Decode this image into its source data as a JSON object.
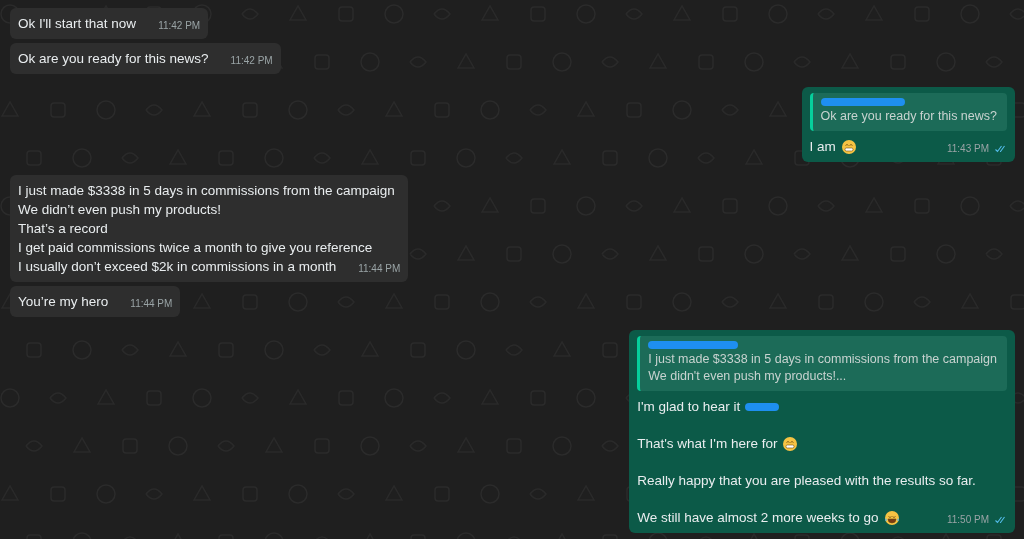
{
  "messages": [
    {
      "sent": false,
      "lines": [
        {
          "text": "Ok I'll start that now"
        }
      ],
      "time": "11:42 PM"
    },
    {
      "sent": false,
      "lines": [
        {
          "text": "Ok are you ready for this news?"
        }
      ],
      "time": "11:42 PM"
    },
    {
      "sent": true,
      "quote": {
        "author_redacted": true,
        "lines": [
          "Ok are you ready for this news?"
        ]
      },
      "lines": [
        {
          "text": "I am",
          "emoji": {
            "kind": "grin"
          }
        }
      ],
      "time": "11:43 PM",
      "read": true
    },
    {
      "sent": false,
      "lines": [
        {
          "text": "I just made $3338 in 5 days in commissions from the campaign"
        },
        {
          "text": "We didn’t even push my products!"
        },
        {
          "text": "That’s a record"
        },
        {
          "text": "I get paid commissions twice a month to give you reference"
        },
        {
          "text": "I usually don’t exceed $2k in commissions in a month"
        }
      ],
      "time": "11:44 PM"
    },
    {
      "sent": false,
      "lines": [
        {
          "text": "You’re my hero"
        }
      ],
      "time": "11:44 PM"
    },
    {
      "sent": true,
      "quote": {
        "author_redacted": true,
        "lines": [
          "I just made $3338 in 5 days in commissions from the campaign",
          "We didn't even push my products!..."
        ]
      },
      "lines": [
        {
          "text": "I'm glad to hear it",
          "redacted": true
        },
        {
          "text": "That's what I'm here for",
          "emoji": {
            "kind": "grin"
          }
        },
        {
          "text": "Really happy that you are pleased with the results so far."
        },
        {
          "text": "We still have almost 2 more weeks to go",
          "emoji": {
            "kind": "joy"
          }
        }
      ],
      "paragraphs": true,
      "time": "11:50 PM",
      "read": true
    }
  ]
}
